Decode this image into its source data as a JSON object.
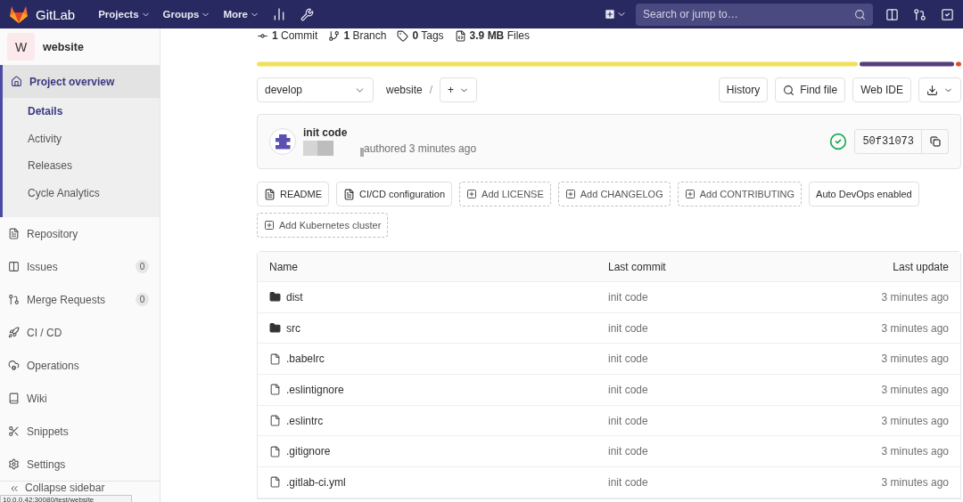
{
  "navbar": {
    "brand": "GitLab",
    "menus": [
      {
        "label": "Projects"
      },
      {
        "label": "Groups"
      },
      {
        "label": "More"
      }
    ],
    "search": {
      "placeholder": "Search or jump to…"
    }
  },
  "sidebar": {
    "project": {
      "initial": "W",
      "name": "website"
    },
    "items": [
      {
        "label": "Project overview",
        "selected": true,
        "expanded": true,
        "children": [
          {
            "label": "Details",
            "selected": true
          },
          {
            "label": "Activity",
            "selected": false
          },
          {
            "label": "Releases",
            "selected": false
          },
          {
            "label": "Cycle Analytics",
            "selected": false
          }
        ]
      },
      {
        "label": "Repository",
        "selected": false
      },
      {
        "label": "Issues",
        "selected": false,
        "count": "0"
      },
      {
        "label": "Merge Requests",
        "selected": false,
        "count": "0"
      },
      {
        "label": "CI / CD",
        "selected": false
      },
      {
        "label": "Operations",
        "selected": false
      },
      {
        "label": "Wiki",
        "selected": false
      },
      {
        "label": "Snippets",
        "selected": false
      },
      {
        "label": "Settings",
        "selected": false
      }
    ],
    "collapse": "Collapse sidebar"
  },
  "stats": [
    {
      "value": "1",
      "label": "Commit"
    },
    {
      "value": "1",
      "label": "Branch"
    },
    {
      "value": "0",
      "label": "Tags"
    },
    {
      "value": "3.9 MB",
      "label": "Files"
    }
  ],
  "toolbar": {
    "branch": "develop",
    "path": "website",
    "separator": "/",
    "plus": "+",
    "buttons": [
      "History",
      "Find file",
      "Web IDE"
    ]
  },
  "commit": {
    "title": "init code",
    "meta": "authored 3 minutes ago",
    "sha": "50f31073"
  },
  "quick_links": [
    {
      "label": "README",
      "kind": "file"
    },
    {
      "label": "CI/CD configuration",
      "kind": "file"
    },
    {
      "label": "Add LICENSE",
      "kind": "add"
    },
    {
      "label": "Add CHANGELOG",
      "kind": "add"
    },
    {
      "label": "Add CONTRIBUTING",
      "kind": "add"
    },
    {
      "label": "Auto DevOps enabled",
      "kind": "plain"
    },
    {
      "label": "Add Kubernetes cluster",
      "kind": "add"
    }
  ],
  "table": {
    "columns": [
      "Name",
      "Last commit",
      "Last update"
    ],
    "rows": [
      {
        "kind": "folder",
        "name": "dist",
        "commit": "init code",
        "updated": "3 minutes ago"
      },
      {
        "kind": "folder",
        "name": "src",
        "commit": "init code",
        "updated": "3 minutes ago"
      },
      {
        "kind": "file",
        "name": ".babelrc",
        "commit": "init code",
        "updated": "3 minutes ago"
      },
      {
        "kind": "file",
        "name": ".eslintignore",
        "commit": "init code",
        "updated": "3 minutes ago"
      },
      {
        "kind": "file",
        "name": ".eslintrc",
        "commit": "init code",
        "updated": "3 minutes ago"
      },
      {
        "kind": "file",
        "name": ".gitignore",
        "commit": "init code",
        "updated": "3 minutes ago"
      },
      {
        "kind": "file",
        "name": ".gitlab-ci.yml",
        "commit": "init code",
        "updated": "3 minutes ago"
      }
    ]
  },
  "status_url": "10.0.0.42:30080/test/website"
}
